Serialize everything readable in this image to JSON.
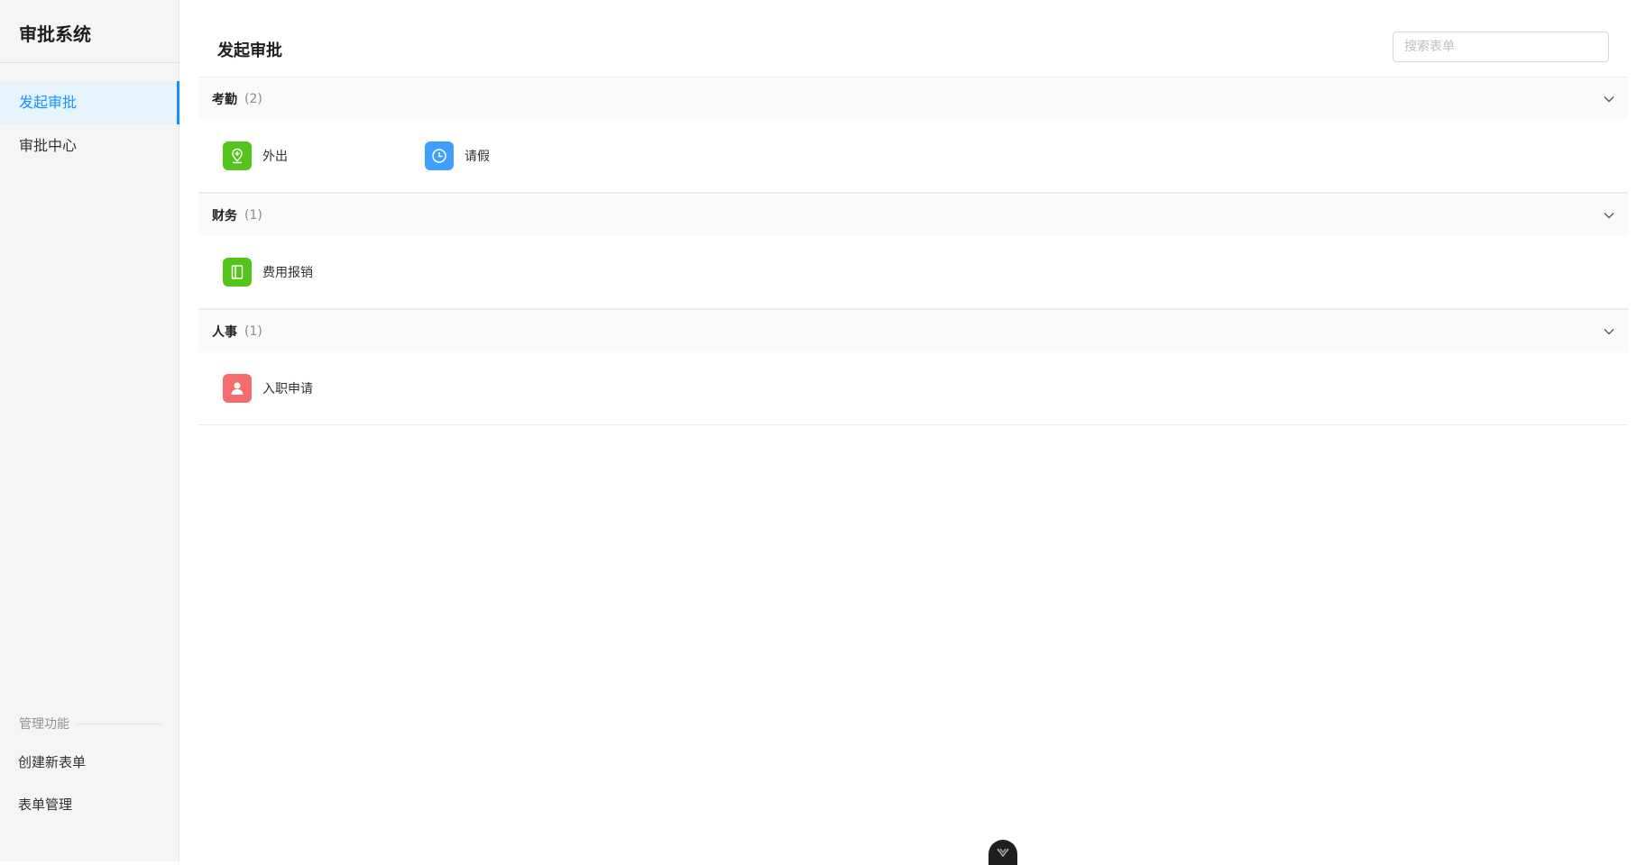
{
  "sidebar": {
    "brand": "审批系统",
    "nav": [
      {
        "label": "发起审批",
        "active": true
      },
      {
        "label": "审批中心",
        "active": false
      }
    ],
    "admin_section_label": "管理功能",
    "admin": [
      {
        "label": "创建新表单"
      },
      {
        "label": "表单管理"
      }
    ]
  },
  "header": {
    "title": "发起审批",
    "search_placeholder": "搜索表单"
  },
  "groups": [
    {
      "name": "考勤",
      "count": "(2)",
      "items": [
        {
          "label": "外出",
          "icon": "location-pin-icon",
          "color": "#52c41a"
        },
        {
          "label": "请假",
          "icon": "clock-icon",
          "color": "#409eff"
        }
      ]
    },
    {
      "name": "财务",
      "count": "(1)",
      "items": [
        {
          "label": "费用报销",
          "icon": "notebook-icon",
          "color": "#52c41a"
        }
      ]
    },
    {
      "name": "人事",
      "count": "(1)",
      "items": [
        {
          "label": "入职申请",
          "icon": "user-icon",
          "color": "#f56c6c"
        }
      ]
    }
  ]
}
